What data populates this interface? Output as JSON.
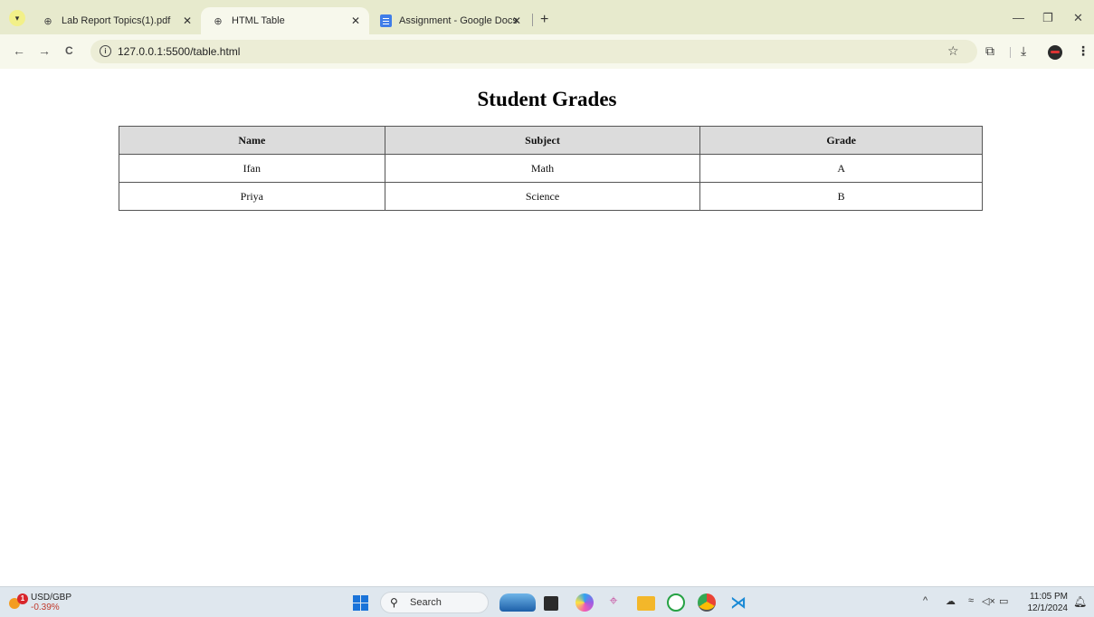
{
  "browser": {
    "tabs": [
      {
        "title": "Lab Report Topics(1).pdf",
        "icon": "globe-icon",
        "active": false
      },
      {
        "title": "HTML Table",
        "icon": "globe-icon",
        "active": true
      },
      {
        "title": "Assignment - Google Docs",
        "icon": "google-docs-icon",
        "active": false
      }
    ],
    "tab_close_glyph": "✕",
    "new_tab_glyph": "+",
    "window_controls": {
      "minimize": "—",
      "restore": "❐",
      "close": "✕"
    },
    "nav": {
      "back": "←",
      "forward": "→",
      "reload": "C"
    },
    "url": "127.0.0.1:5500/table.html"
  },
  "page": {
    "title": "Student Grades",
    "table": {
      "headers": [
        "Name",
        "Subject",
        "Grade"
      ],
      "rows": [
        [
          "Ifan",
          "Math",
          "A"
        ],
        [
          "Priya",
          "Science",
          "B"
        ]
      ]
    }
  },
  "taskbar": {
    "widget": {
      "name": "USD/GBP",
      "value": "-0.39%",
      "badge": "1"
    },
    "search_placeholder": "Search",
    "time": "11:05 PM",
    "date": "12/1/2024"
  },
  "colors": {
    "accent": "#1a73d9",
    "tabstrip": "#e7eacd",
    "toolbar": "#f7f8ec",
    "table_header": "#dcdcdc"
  }
}
